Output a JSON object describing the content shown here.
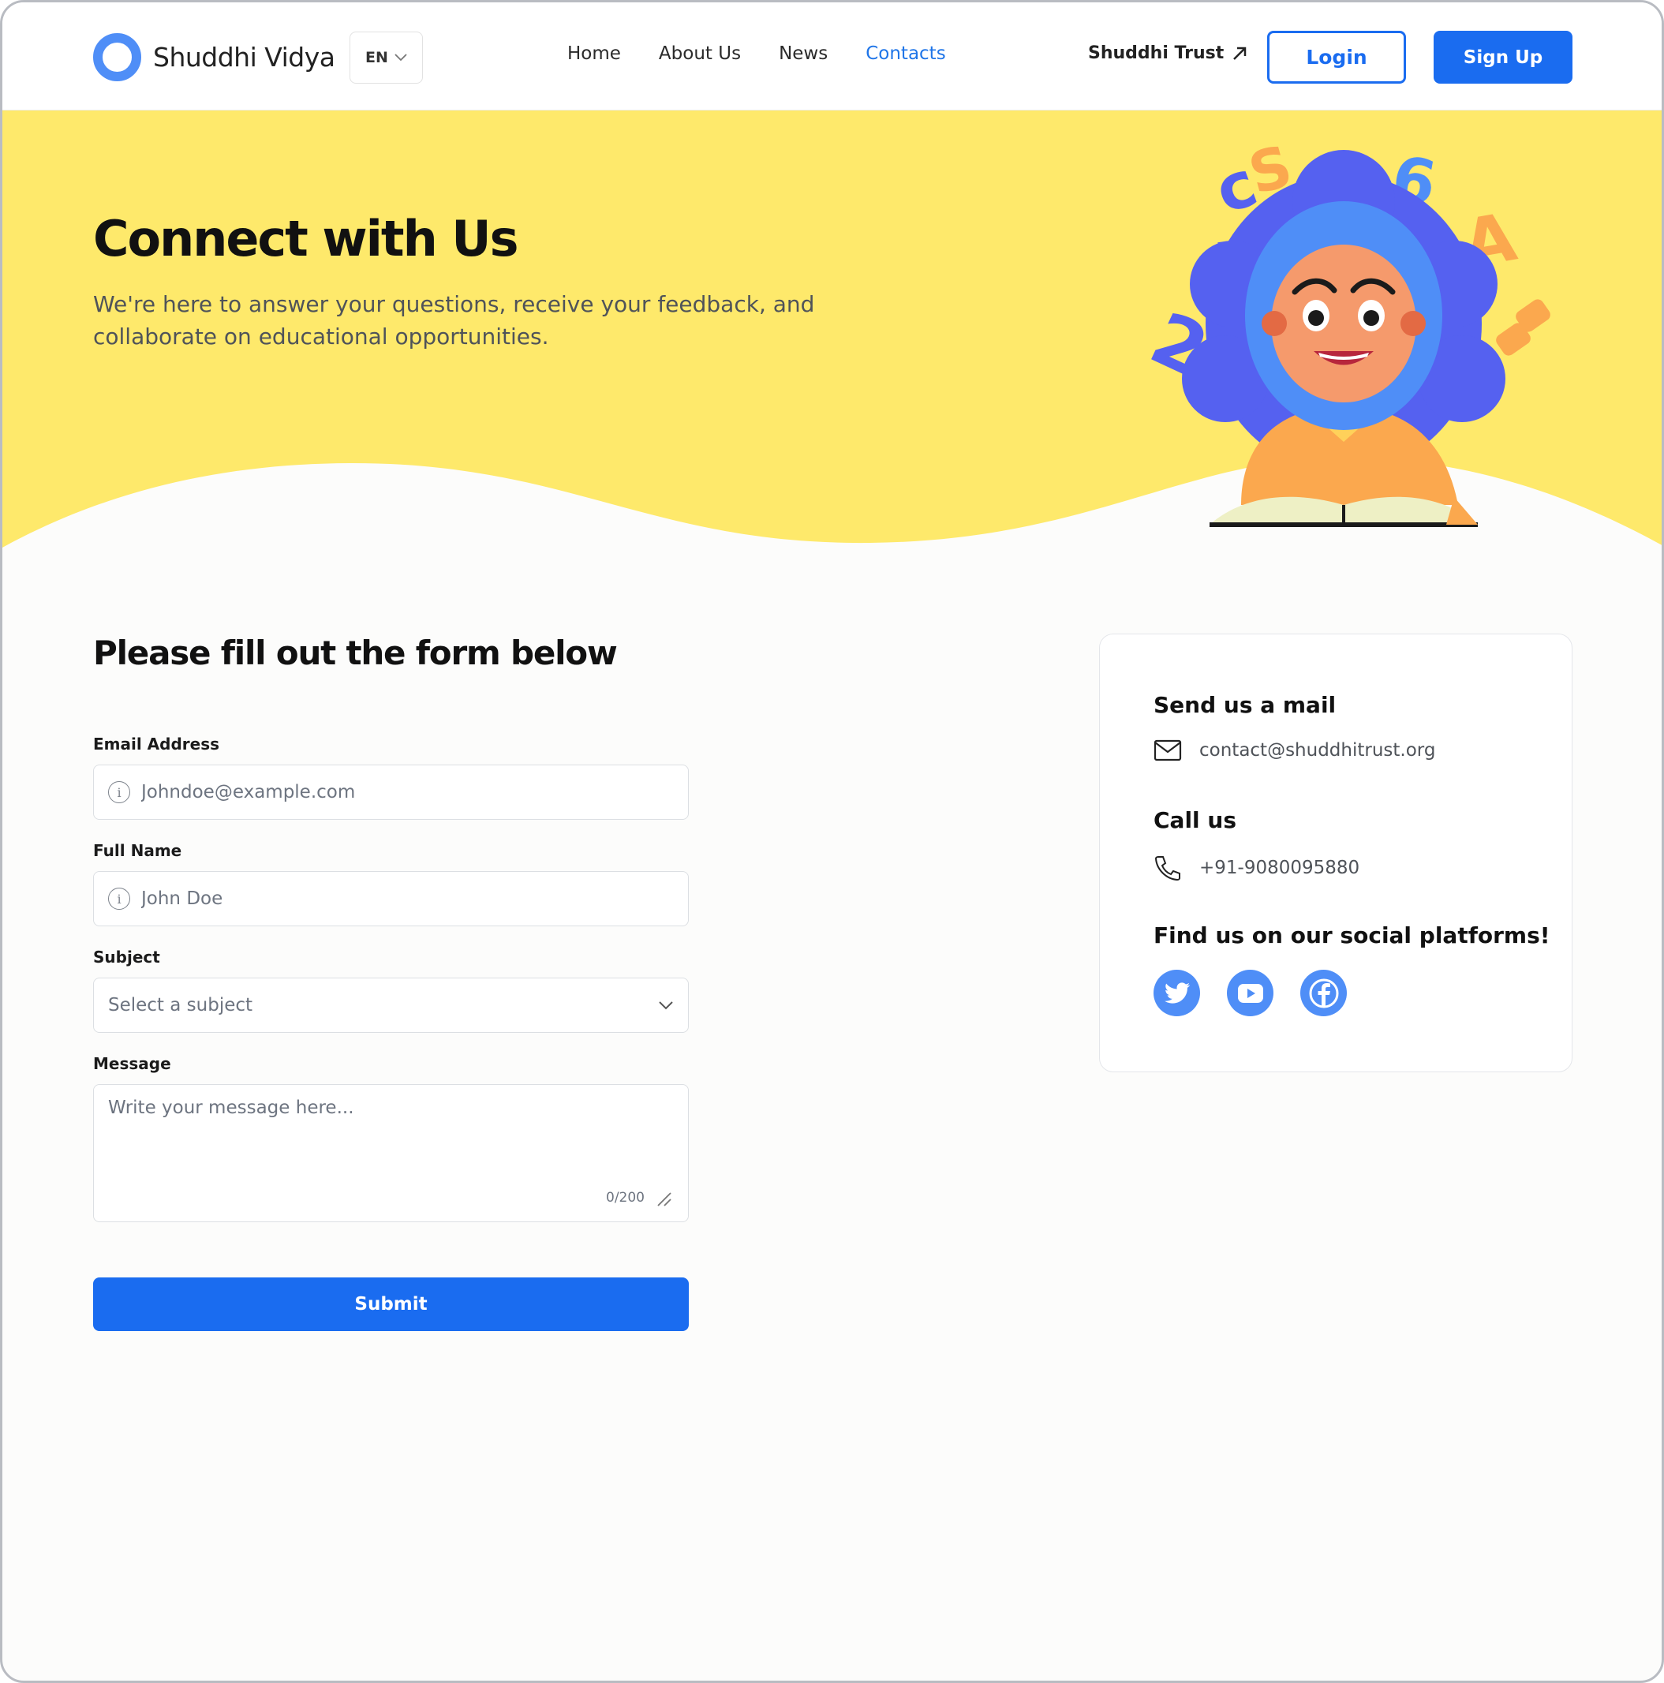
{
  "brand": {
    "name": "Shuddhi Vidya",
    "accent": "#1a6cf0",
    "logo_color": "#4f8ef7"
  },
  "lang": {
    "label": "EN"
  },
  "nav": {
    "items": [
      {
        "label": "Home",
        "active": false
      },
      {
        "label": "About Us",
        "active": false
      },
      {
        "label": "News",
        "active": false
      },
      {
        "label": "Contacts",
        "active": true
      }
    ]
  },
  "header": {
    "trust_link": "Shuddhi Trust",
    "login": "Login",
    "signup": "Sign Up"
  },
  "hero": {
    "title": "Connect with Us",
    "subtitle": "We're here to answer your questions, receive your feedback, and collaborate on educational opportunities.",
    "bg_color": "#fee96b"
  },
  "form": {
    "title": "Please fill out the form below",
    "email": {
      "label": "Email Address",
      "placeholder": "Johndoe@example.com"
    },
    "name": {
      "label": "Full Name",
      "placeholder": "John Doe"
    },
    "subject": {
      "label": "Subject",
      "selected": "Select a subject"
    },
    "message": {
      "label": "Message",
      "placeholder": "Write your message here...",
      "counter": "0/200"
    },
    "submit": "Submit"
  },
  "contact": {
    "mail_heading": "Send us a mail",
    "email": "contact@shuddhitrust.org",
    "call_heading": "Call us",
    "phone": "+91-9080095880",
    "social_heading": "Find us on our social platforms!",
    "socials": [
      "twitter-icon",
      "youtube-icon",
      "facebook-icon"
    ]
  }
}
